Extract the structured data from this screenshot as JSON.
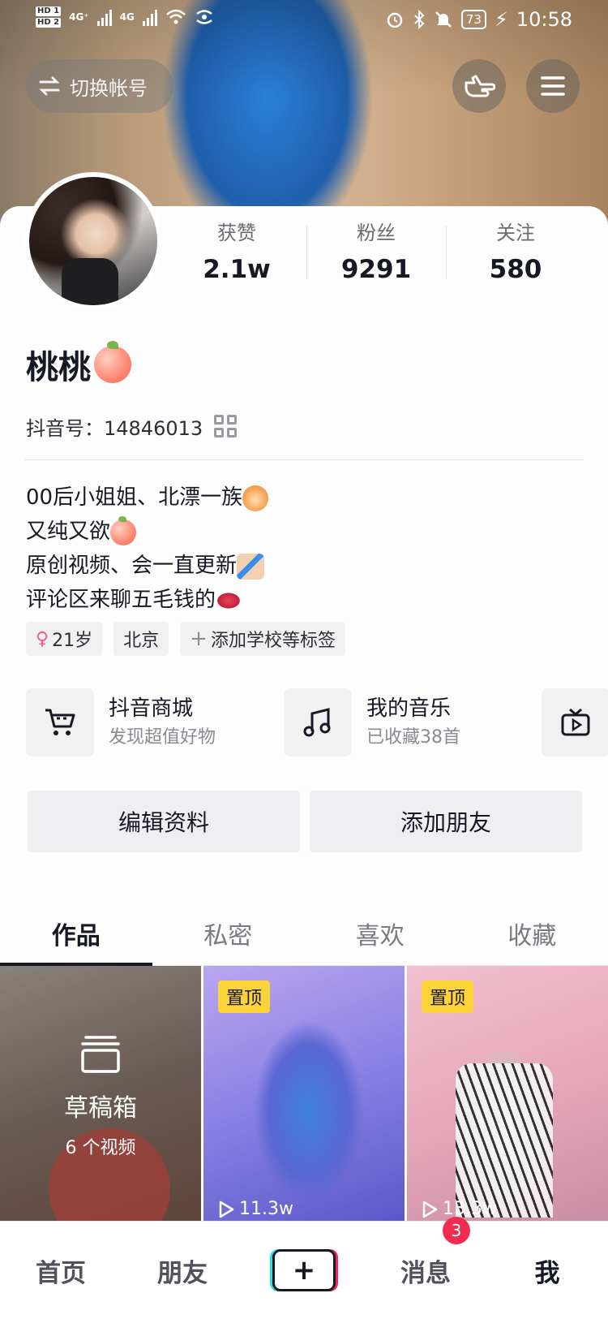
{
  "status_bar": {
    "hd1": "HD 1",
    "hd2": "HD 2",
    "net1": "4G⁺",
    "net2": "4G",
    "battery": "73",
    "time": "10:58"
  },
  "header": {
    "switch_account_label": "切换帐号"
  },
  "stats": [
    {
      "label": "获赞",
      "value": "2.1w"
    },
    {
      "label": "粉丝",
      "value": "9291"
    },
    {
      "label": "关注",
      "value": "580"
    }
  ],
  "profile": {
    "nickname": "桃桃",
    "douyin_id_label": "抖音号：",
    "douyin_id": "14846013",
    "bio": [
      "00后小姐姐、北漂一族",
      "又纯又欲",
      "原创视频、会一直更新",
      "评论区来聊五毛钱的"
    ],
    "tags": {
      "age": "21岁",
      "city": "北京",
      "add_school": "添加学校等标签"
    }
  },
  "services": [
    {
      "title": "抖音商城",
      "subtitle": "发现超值好物"
    },
    {
      "title": "我的音乐",
      "subtitle": "已收藏38首"
    },
    {
      "title": "",
      "subtitle": ""
    }
  ],
  "actions": {
    "edit_profile": "编辑资料",
    "add_friends": "添加朋友"
  },
  "tabs": [
    "作品",
    "私密",
    "喜欢",
    "收藏"
  ],
  "grid": {
    "drafts_title": "草稿箱",
    "drafts_count": "6 个视频",
    "pin_label": "置顶",
    "videos": [
      {
        "views": "11.3w"
      },
      {
        "views": "13.3w"
      }
    ]
  },
  "bottom_nav": {
    "home": "首页",
    "friends": "朋友",
    "plus": "+",
    "messages": "消息",
    "messages_badge": "3",
    "me": "我"
  },
  "colors": {
    "accent_red": "#f02c50",
    "pin_yellow": "#fdd33a",
    "text_primary": "#161823"
  }
}
